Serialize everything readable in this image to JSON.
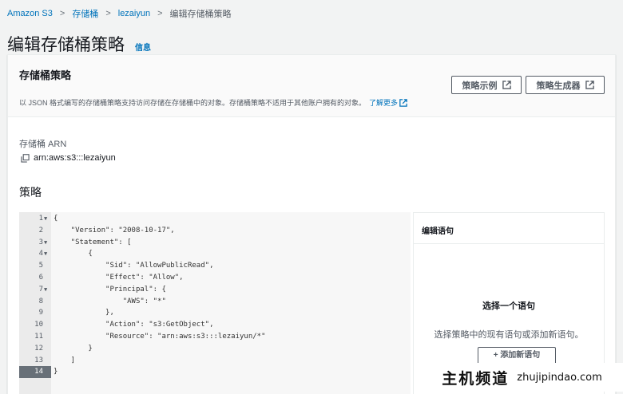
{
  "breadcrumb": {
    "items": [
      "Amazon S3",
      "存储桶",
      "lezaiyun"
    ],
    "current": "编辑存储桶策略"
  },
  "page": {
    "title": "编辑存储桶策略",
    "info_label": "信息"
  },
  "panel": {
    "title": "存储桶策略",
    "description": "以 JSON 格式编写的存储桶策略支持访问存储在存储桶中的对象。存储桶策略不适用于其他账户拥有的对象。",
    "learn_more": "了解更多",
    "btn_examples": "策略示例",
    "btn_generator": "策略生成器",
    "arn_label": "存储桶 ARN",
    "arn_value": "arn:aws:s3:::lezaiyun",
    "policy_heading": "策略"
  },
  "editor": {
    "active_line": 14,
    "lines": [
      {
        "n": "1",
        "fold": "▼",
        "text": "{"
      },
      {
        "n": "2",
        "fold": "",
        "text": "    \"Version\": \"2008-10-17\","
      },
      {
        "n": "3",
        "fold": "▼",
        "text": "    \"Statement\": ["
      },
      {
        "n": "4",
        "fold": "▼",
        "text": "        {"
      },
      {
        "n": "5",
        "fold": "",
        "text": "            \"Sid\": \"AllowPublicRead\","
      },
      {
        "n": "6",
        "fold": "",
        "text": "            \"Effect\": \"Allow\","
      },
      {
        "n": "7",
        "fold": "▼",
        "text": "            \"Principal\": {"
      },
      {
        "n": "8",
        "fold": "",
        "text": "                \"AWS\": \"*\""
      },
      {
        "n": "9",
        "fold": "",
        "text": "            },"
      },
      {
        "n": "10",
        "fold": "",
        "text": "            \"Action\": \"s3:GetObject\","
      },
      {
        "n": "11",
        "fold": "",
        "text": "            \"Resource\": \"arn:aws:s3:::lezaiyun/*\""
      },
      {
        "n": "12",
        "fold": "",
        "text": "        }"
      },
      {
        "n": "13",
        "fold": "",
        "text": "    ]"
      },
      {
        "n": "14",
        "fold": "",
        "text": "}"
      }
    ]
  },
  "side_panel": {
    "title": "编辑语句",
    "heading": "选择一个语句",
    "description": "选择策略中的现有语句或添加新语句。",
    "add_button": "+ 添加新语句"
  },
  "watermark": {
    "cn": "主机频道",
    "en": "zhujipindao.com"
  },
  "colors": {
    "link": "#0073bb",
    "background": "#f2f3f3",
    "text": "#16191f"
  }
}
